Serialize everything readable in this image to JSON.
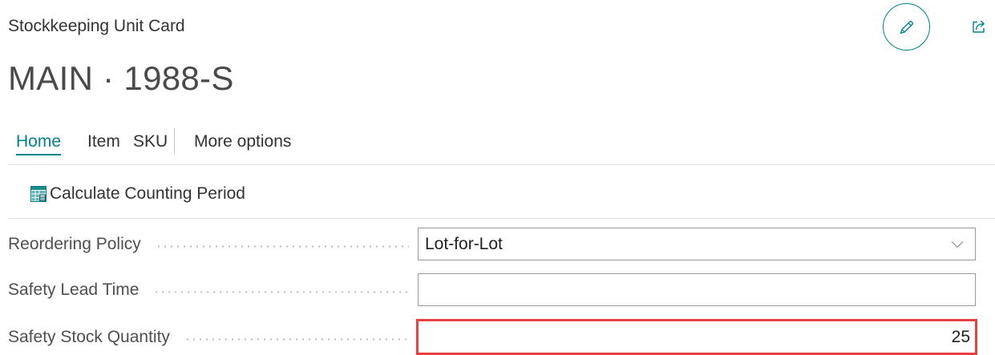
{
  "page": {
    "caption": "Stockkeeping Unit Card",
    "title": "MAIN · 1988-S"
  },
  "header_actions": {
    "edit_icon": "pencil-icon",
    "share_icon": "share-icon"
  },
  "tabs": [
    {
      "label": "Home",
      "active": true
    },
    {
      "label": "Item",
      "active": false
    },
    {
      "label": "SKU",
      "active": false
    }
  ],
  "more_options": {
    "label": "More options"
  },
  "actions": [
    {
      "label": "Calculate Counting Period",
      "icon": "calculate-counting-period-icon"
    }
  ],
  "fields": [
    {
      "label": "Reordering Policy",
      "value": "Lot-for-Lot",
      "icon": "chevron-down-icon"
    },
    {
      "label": "Safety Lead Time",
      "value": ""
    },
    {
      "label": "Safety Stock Quantity",
      "value": "25",
      "highlighted": true
    }
  ],
  "colors": {
    "accent": "#008489",
    "highlight": "#e8403f",
    "text": "#212121"
  }
}
